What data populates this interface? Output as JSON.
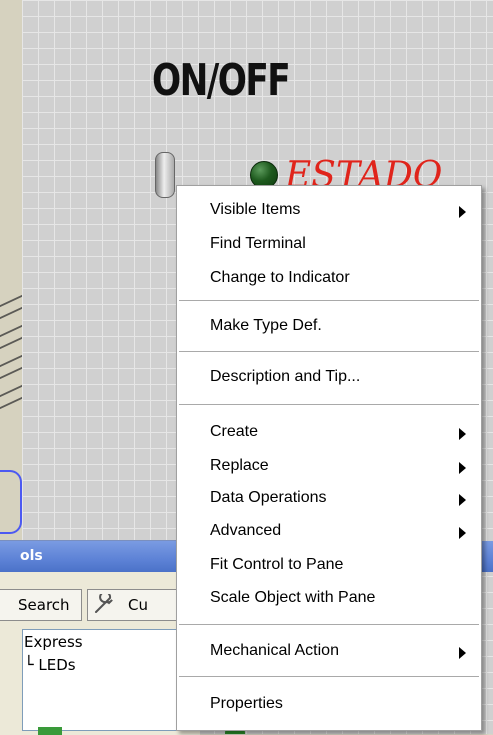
{
  "front_panel": {
    "switch_label": "ON/OFF",
    "led_label": "ESTADO"
  },
  "palette": {
    "title_partial": "ols",
    "search_tab": "Search",
    "custom_tab": "Cu",
    "tree": {
      "express": "Express",
      "leds": "LEDs"
    }
  },
  "context_menu": {
    "items": [
      {
        "label": "Visible Items",
        "submenu": true
      },
      {
        "label": "Find Terminal",
        "submenu": false
      },
      {
        "label": "Change to Indicator",
        "submenu": false
      },
      {
        "label": "Make Type Def.",
        "submenu": false
      },
      {
        "label": "Description and Tip...",
        "submenu": false
      },
      {
        "label": "Create",
        "submenu": true
      },
      {
        "label": "Replace",
        "submenu": true
      },
      {
        "label": "Data Operations",
        "submenu": true
      },
      {
        "label": "Advanced",
        "submenu": true
      },
      {
        "label": "Fit Control to Pane",
        "submenu": false
      },
      {
        "label": "Scale Object with Pane",
        "submenu": false
      },
      {
        "label": "Mechanical Action",
        "submenu": true
      },
      {
        "label": "Properties",
        "submenu": false
      }
    ]
  },
  "colors": {
    "led_label": "#e0241b",
    "titlebar": "#5d82d6",
    "led_off": "#1e5a1e"
  }
}
